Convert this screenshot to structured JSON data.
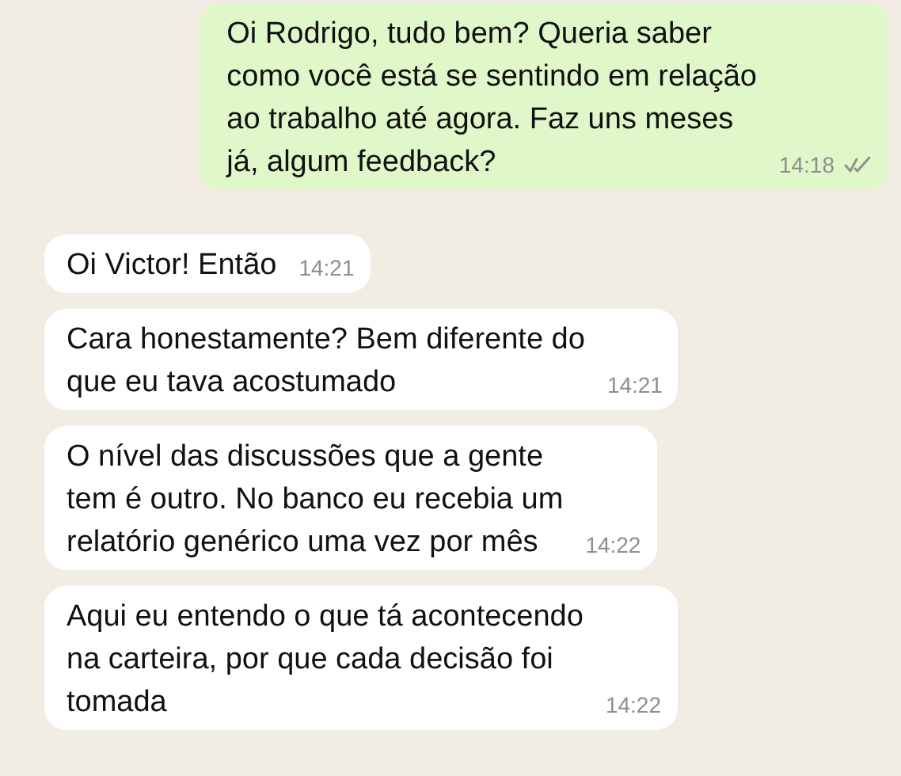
{
  "messages": [
    {
      "kind": "outgoing",
      "lines": [
        "Oi Rodrigo, tudo bem? Queria saber",
        "como você está se sentindo em relação",
        "ao trabalho até agora. Faz uns meses",
        "já, algum feedback?"
      ],
      "time": "14:18",
      "read": false
    },
    {
      "kind": "incoming",
      "lines": [
        "Oi Victor! Então"
      ],
      "time": "14:21"
    },
    {
      "kind": "incoming",
      "lines": [
        "Cara honestamente? Bem diferente do",
        "que eu tava acostumado"
      ],
      "time": "14:21"
    },
    {
      "kind": "incoming",
      "lines": [
        "O nível das discussões que a gente",
        "tem é outro. No banco eu recebia um",
        "relatório genérico uma vez por mês"
      ],
      "time": "14:22"
    },
    {
      "kind": "incoming",
      "lines": [
        "Aqui eu entendo o que tá acontecendo",
        "na carteira, por que cada decisão foi",
        "tomada"
      ],
      "time": "14:22"
    }
  ]
}
